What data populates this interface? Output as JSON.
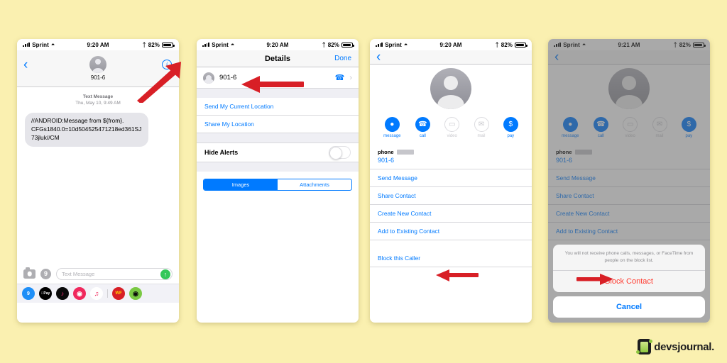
{
  "page": {
    "background_color": "#FAF0B0"
  },
  "brand": {
    "name": "devsjournal.",
    "mark": "phone-logo-icon"
  },
  "phone1": {
    "status": {
      "carrier": "Sprint",
      "time": "9:20 AM",
      "battery": "82%"
    },
    "header": {
      "back": "‹",
      "contact": "901-6",
      "info": "i"
    },
    "timestamp_label": "Text Message",
    "timestamp_value": "Thu, May 10, 9:49 AM",
    "message": "//ANDROID:Message from ${from}. CFGs1840.0=10d504525471218ed361SJ73jluk//CM",
    "input_placeholder": "Text Message",
    "camera_icon": "camera-icon",
    "appstore_icon": "app-store-icon",
    "send_icon": "↑",
    "drawer": [
      {
        "name": "app-store",
        "label": "A",
        "bg": "#1f8ff7",
        "fg": "#ffffff"
      },
      {
        "name": "apple-pay",
        "label": "Pay",
        "bg": "#000000",
        "fg": "#ffffff"
      },
      {
        "name": "music-sticker-app",
        "label": "♪",
        "bg": "#0a0a0a",
        "fg": "#ff2d78"
      },
      {
        "name": "search-app",
        "label": "◎",
        "bg": "#f0285c",
        "fg": "#ffffff"
      },
      {
        "name": "apple-music",
        "label": "♫",
        "bg": "#ffffff",
        "fg": "#f0285c"
      },
      {
        "name": "wf-app",
        "label": "WF",
        "bg": "#d81f26",
        "fg": "#ffd400"
      },
      {
        "name": "green-app",
        "label": "◉",
        "bg": "#7ac943",
        "fg": "#0a0a0a"
      }
    ]
  },
  "phone2": {
    "status": {
      "carrier": "Sprint",
      "time": "9:20 AM",
      "battery": "82%"
    },
    "nav": {
      "title": "Details",
      "done": "Done"
    },
    "contact": {
      "name": "901-6",
      "call_icon": "phone-icon",
      "disclosure": "›"
    },
    "rows": [
      "Send My Current Location",
      "Share My Location"
    ],
    "hide_alerts_label": "Hide Alerts",
    "hide_alerts_state": "off",
    "segments": [
      "Images",
      "Attachments"
    ],
    "segment_selected": "Images"
  },
  "phone3": {
    "status": {
      "carrier": "Sprint",
      "time": "9:20 AM",
      "battery": "82%"
    },
    "back": "‹",
    "actions": [
      {
        "label": "message",
        "icon": "message-bubble-icon",
        "glyph": "●",
        "enabled": true
      },
      {
        "label": "call",
        "icon": "phone-icon",
        "glyph": "✆",
        "enabled": true
      },
      {
        "label": "video",
        "icon": "video-camera-icon",
        "glyph": "▭",
        "enabled": false
      },
      {
        "label": "mail",
        "icon": "envelope-icon",
        "glyph": "✉",
        "enabled": false
      },
      {
        "label": "pay",
        "icon": "dollar-icon",
        "glyph": "$",
        "enabled": true
      }
    ],
    "phone_label": "phone",
    "phone_value": "901-6",
    "rows": [
      "Send Message",
      "Share Contact",
      "Create New Contact",
      "Add to Existing Contact"
    ],
    "block_row": "Block this Caller"
  },
  "phone4": {
    "status": {
      "carrier": "Sprint",
      "time": "9:21 AM",
      "battery": "82%"
    },
    "back": "‹",
    "actions": [
      {
        "label": "message",
        "icon": "message-bubble-icon",
        "glyph": "●"
      },
      {
        "label": "call",
        "icon": "phone-icon",
        "glyph": "✆"
      },
      {
        "label": "video",
        "icon": "video-camera-icon",
        "glyph": "▭"
      },
      {
        "label": "mail",
        "icon": "envelope-icon",
        "glyph": "✉"
      },
      {
        "label": "pay",
        "icon": "dollar-icon",
        "glyph": "$"
      }
    ],
    "phone_label": "phone",
    "phone_value": "901-6",
    "rows": [
      "Send Message",
      "Share Contact",
      "Create New Contact",
      "Add to Existing Contact"
    ],
    "sheet": {
      "message": "You will not receive phone calls, messages, or FaceTime from people on the block list.",
      "confirm": "Block Contact",
      "cancel": "Cancel"
    }
  },
  "annotations": {
    "color": "#d81f26",
    "arrows": [
      {
        "name": "arrow-to-info-button"
      },
      {
        "name": "arrow-to-contact-row"
      },
      {
        "name": "arrow-to-block-this-caller"
      },
      {
        "name": "arrow-to-block-contact"
      }
    ]
  }
}
